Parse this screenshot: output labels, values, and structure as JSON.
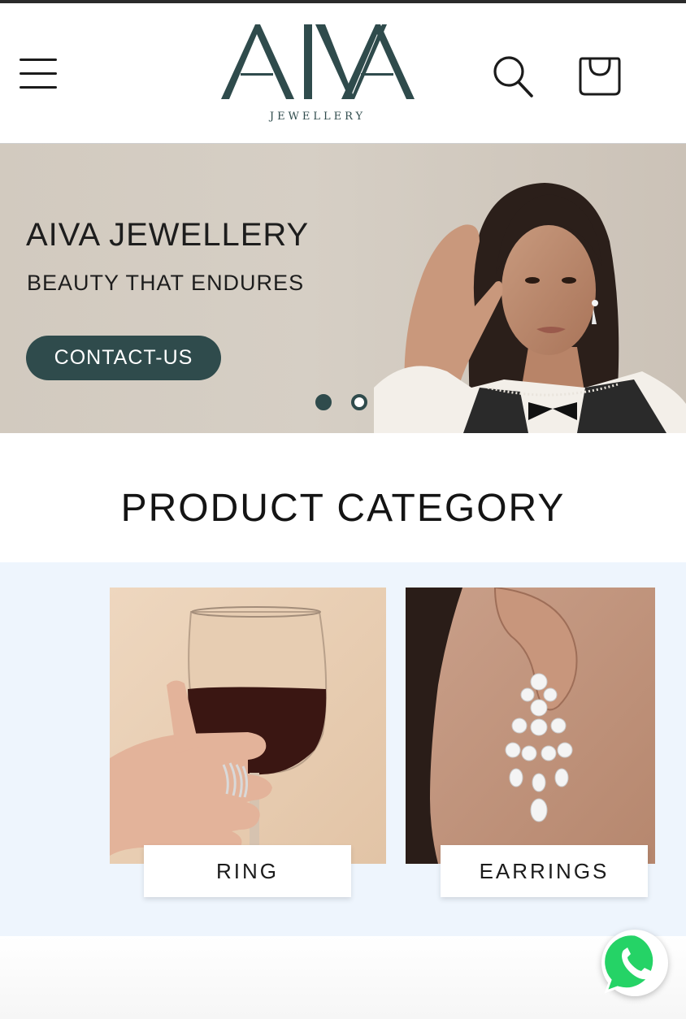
{
  "header": {
    "brand": "AIVA",
    "brand_sub": "JEWELLERY",
    "menu_icon": "hamburger-menu-icon",
    "search_icon": "search-icon",
    "cart_icon": "shopping-bag-icon"
  },
  "hero": {
    "title": "AIVA JEWELLERY",
    "subtitle": "BEAUTY THAT ENDURES",
    "cta_label": "CONTACT-US",
    "slides_total": 2,
    "active_slide": 1
  },
  "categories": {
    "heading": "PRODUCT CATEGORY",
    "items": [
      {
        "label": "RING"
      },
      {
        "label": "EARRINGS"
      }
    ]
  },
  "colors": {
    "brand_teal": "#2f4b4c",
    "category_bg": "#eef5fd",
    "whatsapp_green": "#25d366"
  },
  "floating": {
    "whatsapp_icon": "whatsapp-icon"
  }
}
